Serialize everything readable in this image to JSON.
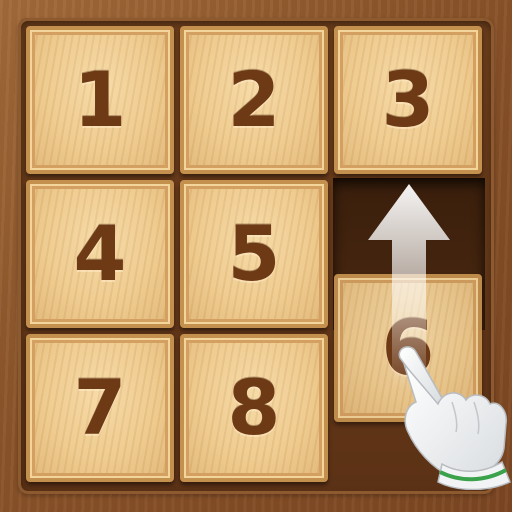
{
  "game": {
    "name": "sliding-number-puzzle",
    "grid_size": 3,
    "empty_cell": {
      "row": 2,
      "col": 3
    },
    "moving_tile": {
      "label": "6",
      "direction": "up"
    }
  },
  "tiles": [
    {
      "label": "1",
      "row": 1,
      "col": 1
    },
    {
      "label": "2",
      "row": 1,
      "col": 2
    },
    {
      "label": "3",
      "row": 1,
      "col": 3
    },
    {
      "label": "4",
      "row": 2,
      "col": 1
    },
    {
      "label": "5",
      "row": 2,
      "col": 2
    },
    {
      "label": "6",
      "row": 3,
      "col": 3
    },
    {
      "label": "7",
      "row": 3,
      "col": 1
    },
    {
      "label": "8",
      "row": 3,
      "col": 2
    }
  ],
  "icons": {
    "swipe": "arrow-up-icon",
    "pointer": "pointing-hand-icon"
  },
  "colors": {
    "background_wood": "#8a5329",
    "board_frame": "#5c3216",
    "tile_face": "#f0cc8e",
    "tile_border": "#c4904e",
    "number_text": "#6e3a16",
    "empty_slot": "#3a1f0c",
    "cuff_stripe": "#3aa24a"
  }
}
